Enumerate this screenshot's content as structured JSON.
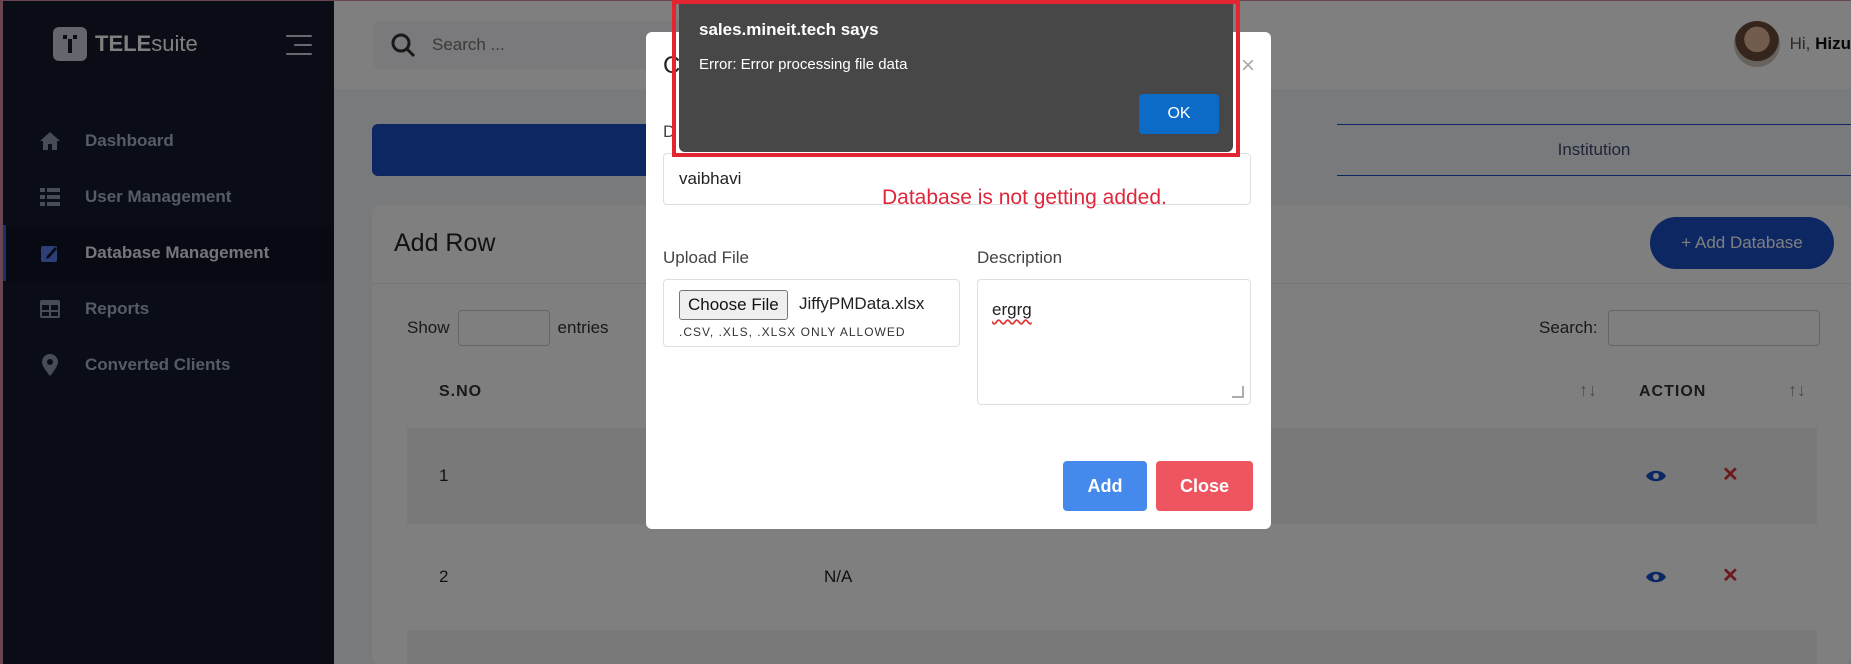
{
  "sidebar": {
    "logo_text_bold": "TELE",
    "logo_text": "suite",
    "items": [
      {
        "label": "Dashboard",
        "icon": "home-icon"
      },
      {
        "label": "User Management",
        "icon": "list-icon"
      },
      {
        "label": "Database Management",
        "icon": "edit-icon",
        "active": true
      },
      {
        "label": "Reports",
        "icon": "table-icon"
      },
      {
        "label": "Converted Clients",
        "icon": "location-pin-icon"
      }
    ]
  },
  "topbar": {
    "search_placeholder": "Search ...",
    "greeting": "Hi,",
    "user_name": "Hizu"
  },
  "tabs": [
    {
      "label": ""
    },
    {
      "label": ""
    },
    {
      "label": "Institution"
    }
  ],
  "card": {
    "title": "Add Row",
    "add_database_label": "+ Add Database",
    "show_label": "Show",
    "entries_label": "entries",
    "search_label": "Search:",
    "columns": [
      "S.NO",
      "ACTION"
    ],
    "rows": [
      {
        "sno": "1",
        "value": ""
      },
      {
        "sno": "2",
        "value": "N/A"
      }
    ]
  },
  "modal": {
    "title": "C",
    "close_glyph": "×",
    "name_label": "D",
    "name_value": "vaibhavi",
    "upload_label": "Upload File",
    "choose_file_label": "Choose File",
    "file_name": "JiffyPMData.xlsx",
    "upload_hint": ".CSV, .XLS, .XLSX ONLY ALLOWED",
    "description_label": "Description",
    "description_value": "ergrg",
    "add_label": "Add",
    "close_label": "Close"
  },
  "annotation": "Database is not getting added.",
  "alert": {
    "title": "sales.mineit.tech says",
    "message": "Error: Error processing file data",
    "ok_label": "OK"
  },
  "colors": {
    "sidebar_bg": "#141b2d",
    "primary": "#1b4fc7",
    "add_button": "#4589ec",
    "close_button": "#ef5561",
    "alert_bg": "#474747",
    "alert_ok": "#0b6bc7",
    "highlight_red": "#e32431"
  }
}
